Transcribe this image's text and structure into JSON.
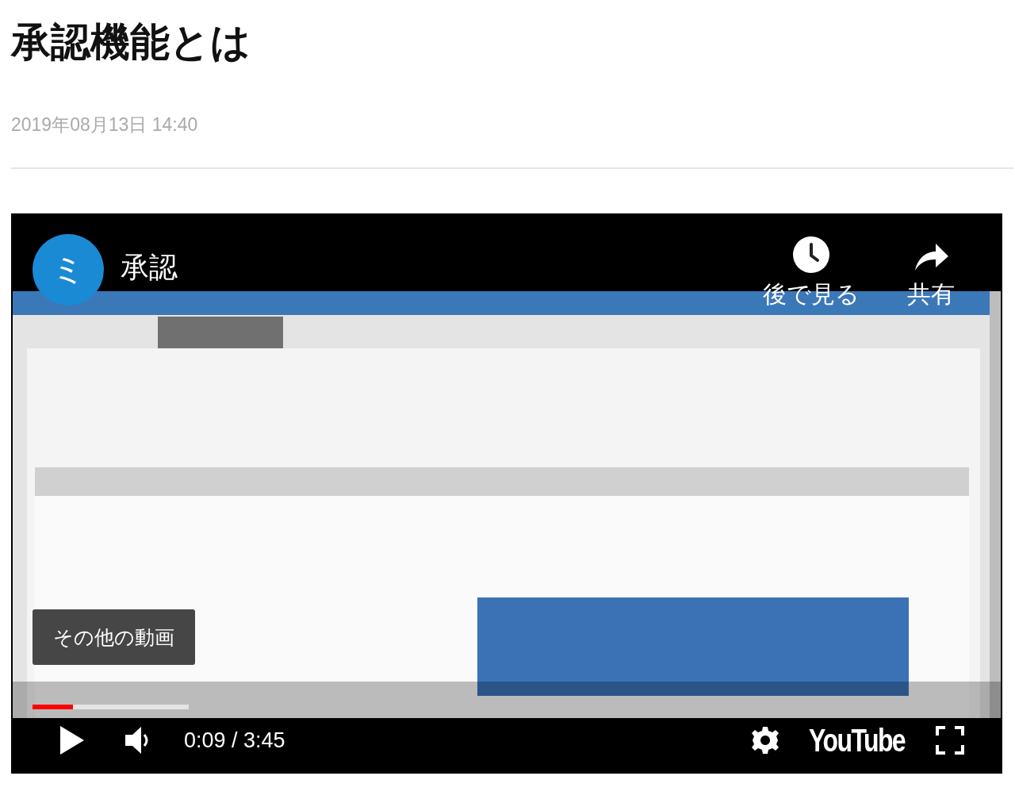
{
  "article": {
    "title": "承認機能とは",
    "date": "2019年08月13日 14:40"
  },
  "video": {
    "kind": "picture",
    "channel_avatar": "ミ",
    "title": "承認",
    "actions": [
      {
        "kind": "watch_later",
        "label": "後で見る"
      },
      {
        "kind": "share",
        "label": "共有"
      }
    ],
    "more_videos": "その他の動画",
    "progress": {
      "level": 0.26
    },
    "time": "0:09 / 3:45",
    "logo": "YouTube",
    "paused": true
  }
}
